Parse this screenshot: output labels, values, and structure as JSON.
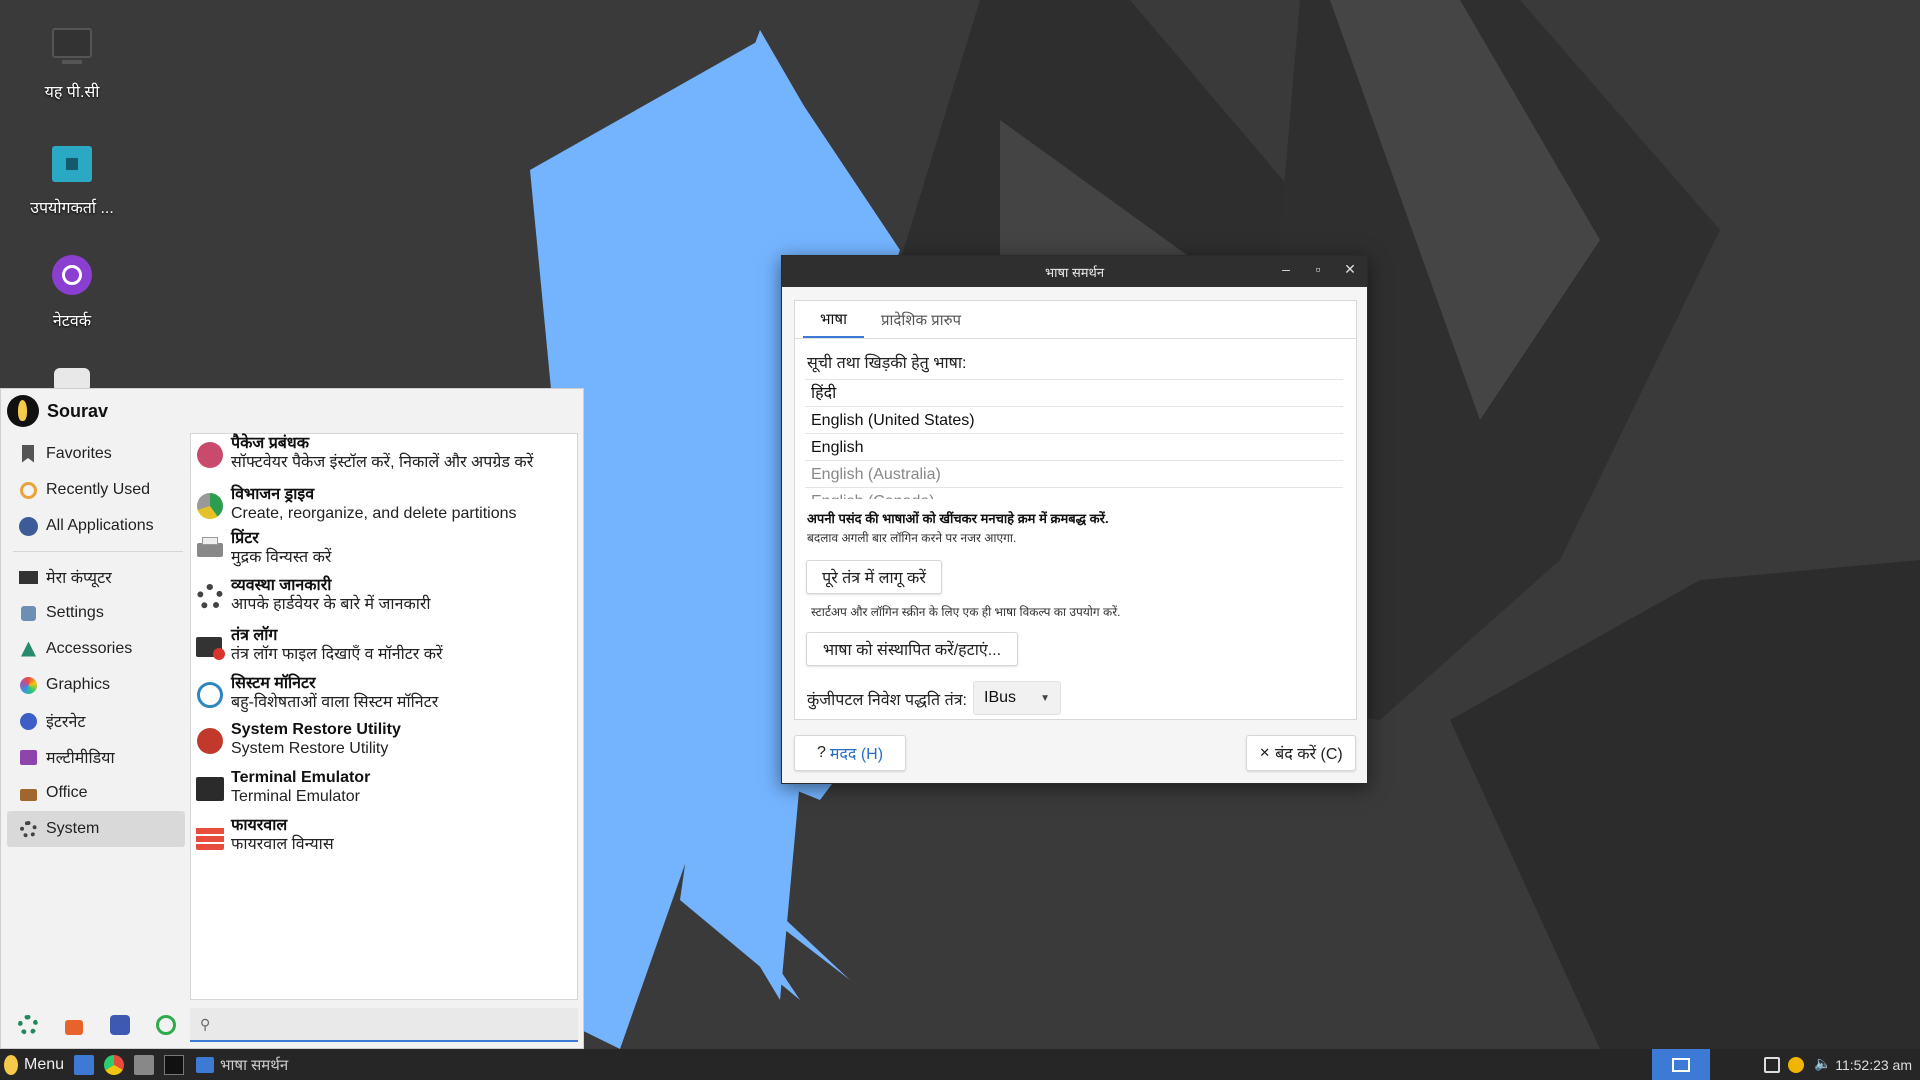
{
  "desktop": {
    "icons": [
      {
        "label": "यह पी.सी",
        "icon": "computer-icon"
      },
      {
        "label": "उपयोगकर्ता ...",
        "icon": "home-folder-icon"
      },
      {
        "label": "नेटवर्क",
        "icon": "network-icon"
      }
    ]
  },
  "menu": {
    "user": "Sourav",
    "categories": [
      {
        "label": "Favorites",
        "icon": "bookmark-icon"
      },
      {
        "label": "Recently Used",
        "icon": "clock-icon"
      },
      {
        "label": "All Applications",
        "icon": "apps-icon"
      },
      {
        "label": "मेरा कंप्यूटर",
        "icon": "computer-icon"
      },
      {
        "label": "Settings",
        "icon": "settings-icon"
      },
      {
        "label": "Accessories",
        "icon": "accessories-icon"
      },
      {
        "label": "Graphics",
        "icon": "graphics-icon"
      },
      {
        "label": "इंटरनेट",
        "icon": "internet-icon"
      },
      {
        "label": "मल्टीमीडिया",
        "icon": "multimedia-icon"
      },
      {
        "label": "Office",
        "icon": "briefcase-icon"
      },
      {
        "label": "System",
        "icon": "gear-icon"
      }
    ],
    "apps": [
      {
        "name": "पैकेज प्रबंधक",
        "desc": "सॉफ्टवेयर पैकेज इंस्टॉल करें, निकालें और अपग्रेड करें",
        "icon": "package-manager-icon"
      },
      {
        "name": "विभाजन ड्राइव",
        "desc": "Create, reorganize, and delete partitions",
        "icon": "partition-icon"
      },
      {
        "name": "प्रिंटर",
        "desc": "मुद्रक विन्यस्त करें",
        "icon": "printer-icon"
      },
      {
        "name": "व्यवस्था जानकारी",
        "desc": "आपके हार्डवेयर के बारे में जानकारी",
        "icon": "system-info-icon"
      },
      {
        "name": "तंत्र लॉग",
        "desc": "तंत्र लॉग फाइल दिखाएँ व मॉनीटर करें",
        "icon": "system-log-icon"
      },
      {
        "name": "सिस्टम मॉनिटर",
        "desc": "बहु-विशेषताओं वाला सिस्टम मॉनिटर",
        "icon": "system-monitor-icon"
      },
      {
        "name": "System Restore Utility",
        "desc": "System Restore Utility",
        "icon": "restore-icon"
      },
      {
        "name": "Terminal Emulator",
        "desc": "Terminal Emulator",
        "icon": "terminal-icon"
      },
      {
        "name": "फायरवाल",
        "desc": "फायरवाल विन्यास",
        "icon": "firewall-icon"
      }
    ],
    "bottom_icons": [
      "software-manager-icon",
      "lock-icon",
      "switch-user-icon",
      "logout-icon"
    ],
    "search": {
      "value": "",
      "placeholder": ""
    }
  },
  "dialog": {
    "title": "भाषा समर्थन",
    "tabs": [
      "भाषा",
      "प्रादेशिक प्रारुप"
    ],
    "lang_label": "सूची तथा खिड़की हेतु भाषा:",
    "languages": [
      "हिंदी",
      "English (United States)",
      "English",
      "English (Australia)",
      "English (Canada)"
    ],
    "drag_hint": "अपनी पसंद की भाषाओं को खींचकर मनचाहे क्रम में क्रमबद्ध करें.",
    "relogin_hint": "बदलाव अगली बार लॉगिन करने पर नजर आएगा.",
    "apply_button": "पूरे तंत्र में लागू करें",
    "startup_hint": "स्टार्टअप और लॉगिन स्क्रीन के लिए एक ही भाषा विकल्प का उपयोग करें.",
    "install_button": "भाषा को संस्थापित करें/हटाएं...",
    "kbd_label": "कुंजीपटल निवेश पद्धति तंत्र:",
    "kbd_value": "IBus",
    "help_button": "मदद (H)",
    "close_button": "बंद करें (C)"
  },
  "taskbar": {
    "menu_label": "Menu",
    "window_title": "भाषा समर्थन",
    "clock": "11:52:23 am"
  },
  "colors": {
    "accent": "#3d7ad6",
    "wallpaper_blue": "#74b4ff",
    "dark": "#262626"
  }
}
